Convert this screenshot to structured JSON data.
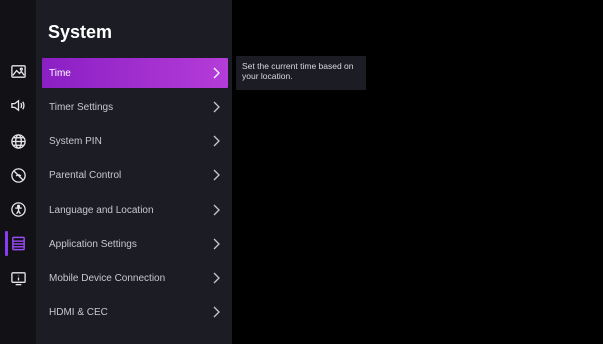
{
  "panel": {
    "title": "System"
  },
  "menu": {
    "items": [
      {
        "label": "Time"
      },
      {
        "label": "Timer Settings"
      },
      {
        "label": "System PIN"
      },
      {
        "label": "Parental Control"
      },
      {
        "label": "Language and Location"
      },
      {
        "label": "Application Settings"
      },
      {
        "label": "Mobile Device Connection"
      },
      {
        "label": "HDMI & CEC"
      }
    ],
    "selected": "Time"
  },
  "tooltip": {
    "text": "Set the current time based on your location."
  },
  "rail": {
    "icons": [
      "picture-icon",
      "sound-icon",
      "network-icon",
      "accessibility-off-icon",
      "accessibility-icon",
      "system-icon",
      "support-icon"
    ],
    "active": "system-icon"
  },
  "colors": {
    "accent": "#8a3cf0",
    "highlight_start": "#8a1fc4",
    "highlight_end": "#b53cd8",
    "panel_bg": "#1c1c24",
    "rail_bg": "#111116"
  }
}
